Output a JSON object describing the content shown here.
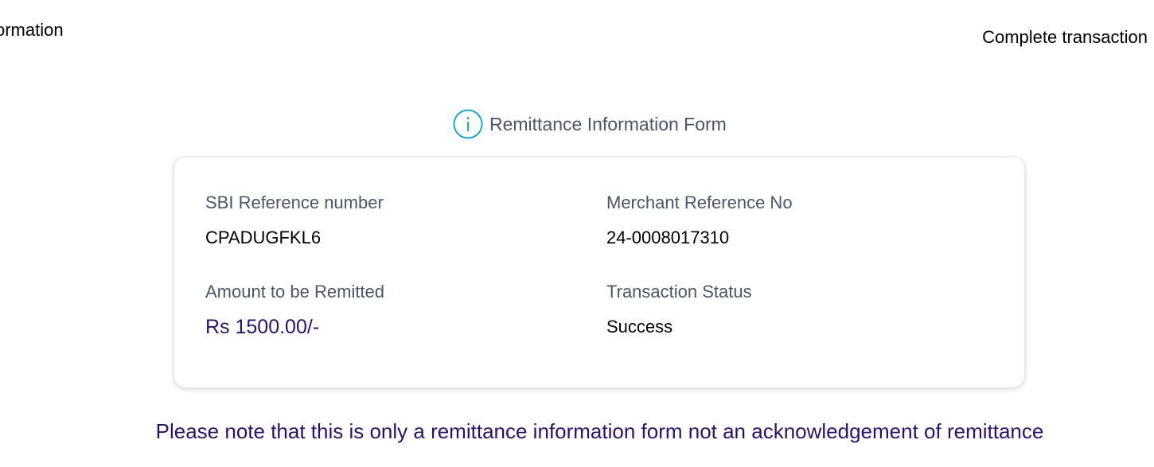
{
  "stepper": {
    "left_step_label": "ormation",
    "right_step_label": "Complete transaction"
  },
  "form": {
    "icon": "info-circle-icon",
    "title": "Remittance Information Form",
    "accent_color": "#1aa3d9",
    "fields": [
      {
        "label": "SBI Reference number",
        "value": "CPADUGFKL6"
      },
      {
        "label": "Merchant Reference No",
        "value": "24-0008017310"
      },
      {
        "label": "Amount to be Remitted",
        "value": "Rs 1500.00/-"
      },
      {
        "label": "Transaction Status",
        "value": "Success"
      }
    ]
  },
  "note": "Please note that this is only a remittance information form not an acknowledgement of remittance",
  "colors": {
    "label": "#4f5565",
    "highlight": "#2a1367"
  }
}
